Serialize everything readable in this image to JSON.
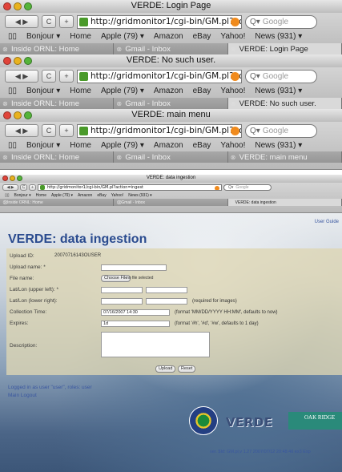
{
  "windows": [
    {
      "title": "VERDE: Login Page",
      "url": "http://gridmonitor1/cgi-bin/GM.pl?actio",
      "search_placeholder": "Google",
      "bookmarks": [
        "Bonjour ▾",
        "Home",
        "Apple (79) ▾",
        "Amazon",
        "eBay",
        "Yahoo!",
        "News (931) ▾"
      ],
      "tabs": [
        "Inside ORNL: Home",
        "Gmail - Inbox",
        "VERDE: Login Page"
      ],
      "active_tab": 2
    },
    {
      "title": "VERDE: No such user.",
      "url": "http://gridmonitor1/cgi-bin/GM.pl?actio",
      "search_placeholder": "Google",
      "bookmarks": [
        "Bonjour ▾",
        "Home",
        "Apple (79) ▾",
        "Amazon",
        "eBay",
        "Yahoo!",
        "News (931) ▾"
      ],
      "tabs": [
        "Inside ORNL: Home",
        "Gmail - Inbox",
        "VERDE: No such user."
      ],
      "active_tab": 2
    },
    {
      "title": "VERDE: main menu",
      "url": "http://gridmonitor1/cgi-bin/GM.pl?actio",
      "search_placeholder": "Google",
      "bookmarks": [
        "Bonjour ▾",
        "Home",
        "Apple (79) ▾",
        "Amazon",
        "eBay",
        "Yahoo!",
        "News (931) ▾"
      ],
      "tabs": [
        "Inside ORNL: Home",
        "Gmail - Inbox",
        "VERDE: main menu"
      ],
      "active_tab": 2
    },
    {
      "title": "VERDE: data ingestion",
      "url": "http://gridmonitor1/cgi-bin/GM.pl?action=ingest",
      "search_placeholder": "Google",
      "bookmarks": [
        "Bonjour ▾",
        "Home",
        "Apple (79) ▾",
        "Amazon",
        "eBay",
        "Yahoo!",
        "News (931) ▾"
      ],
      "tabs": [
        "Inside ORNL: Home",
        "Gmail - Inbox",
        "VERDE: data ingestion"
      ],
      "active_tab": 2
    }
  ],
  "page": {
    "help_link": "User Guide",
    "heading": "VERDE: data ingestion",
    "form": {
      "upload_id_label": "Upload ID:",
      "upload_id_value": "20070716143OUSER",
      "upload_name_label": "Upload name: *",
      "file_name_label": "File name:",
      "choose_file_button": "Choose File",
      "no_file_text": "no file selected",
      "latlon_ul_label": "Lat/Lon (upper left): *",
      "latlon_lr_label": "Lat/Lon (lower right):",
      "latlon_hint": "(required for images)",
      "collection_time_label": "Collection Time:",
      "collection_time_value": "07/16/2007 14:30",
      "collection_time_hint": "(format 'MM/DD/YYYY HH:MM', defaults to now)",
      "expires_label": "Expires:",
      "expires_value": "1d",
      "expires_hint": "(format '#h', '#d', '#w', defaults to 1 day)",
      "description_label": "Description:",
      "upload_button": "Upload",
      "reset_button": "Reset"
    },
    "logged_in_text": "Logged in as user \"user\", roles: user",
    "main_logout": "Main Logout",
    "verde_logo": "VERDE",
    "ornl_logo": "OAK RIDGE",
    "footer": "ver. $Id: GM.pl,v 1.27 2007/07/12 20:48:46 ex3 Exp"
  }
}
